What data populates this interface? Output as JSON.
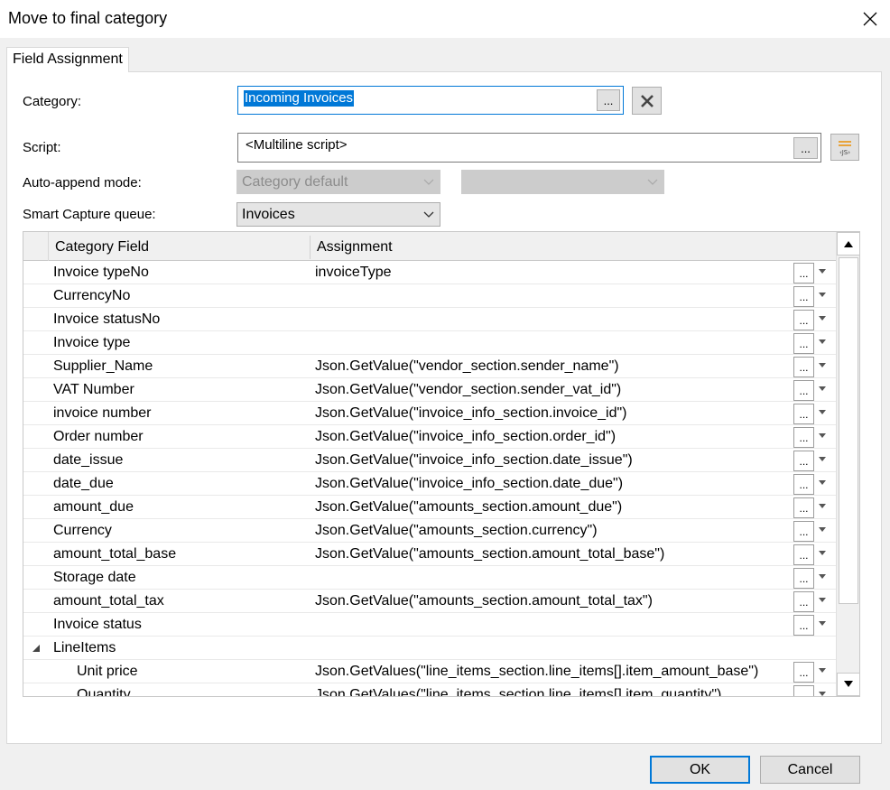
{
  "window": {
    "title": "Move to final category"
  },
  "tabs": [
    {
      "label": "Field Assignment"
    }
  ],
  "form": {
    "category_label": "Category:",
    "category_value": "Incoming Invoices",
    "dots": "...",
    "script_label": "Script:",
    "script_value": "<Multiline script>",
    "auto_append_label": "Auto-append mode:",
    "auto_append_value": "Category default",
    "auto_append_second_value": "",
    "smart_capture_label": "Smart Capture queue:",
    "smart_capture_value": "Invoices",
    "script_editor_icon_text": "‹JS›"
  },
  "grid": {
    "columns": [
      {
        "label": "Category Field"
      },
      {
        "label": "Assignment"
      }
    ],
    "rows": [
      {
        "field": "Invoice typeNo",
        "assignment": "invoiceType"
      },
      {
        "field": "CurrencyNo",
        "assignment": ""
      },
      {
        "field": "Invoice statusNo",
        "assignment": ""
      },
      {
        "field": "Invoice type",
        "assignment": ""
      },
      {
        "field": "Supplier_Name",
        "assignment": "Json.GetValue(\"vendor_section.sender_name\")"
      },
      {
        "field": "VAT Number",
        "assignment": "Json.GetValue(\"vendor_section.sender_vat_id\")"
      },
      {
        "field": "invoice number",
        "assignment": "Json.GetValue(\"invoice_info_section.invoice_id\")"
      },
      {
        "field": "Order number",
        "assignment": "Json.GetValue(\"invoice_info_section.order_id\")"
      },
      {
        "field": "date_issue",
        "assignment": "Json.GetValue(\"invoice_info_section.date_issue\")"
      },
      {
        "field": "date_due",
        "assignment": "Json.GetValue(\"invoice_info_section.date_due\")"
      },
      {
        "field": "amount_due",
        "assignment": "Json.GetValue(\"amounts_section.amount_due\")"
      },
      {
        "field": "Currency",
        "assignment": "Json.GetValue(\"amounts_section.currency\")"
      },
      {
        "field": "amount_total_base",
        "assignment": "Json.GetValue(\"amounts_section.amount_total_base\")"
      },
      {
        "field": "Storage date",
        "assignment": ""
      },
      {
        "field": "amount_total_tax",
        "assignment": "Json.GetValue(\"amounts_section.amount_total_tax\")"
      },
      {
        "field": "Invoice status",
        "assignment": ""
      },
      {
        "field": "LineItems",
        "assignment": ""
      },
      {
        "field": "Unit price",
        "assignment": "Json.GetValues(\"line_items_section.line_items[].item_amount_base\")"
      },
      {
        "field": "Quantity",
        "assignment": "Json.GetValues(\"line_items_section.line_items[].item_quantity\")"
      }
    ]
  },
  "buttons": {
    "ok": "OK",
    "cancel": "Cancel"
  }
}
